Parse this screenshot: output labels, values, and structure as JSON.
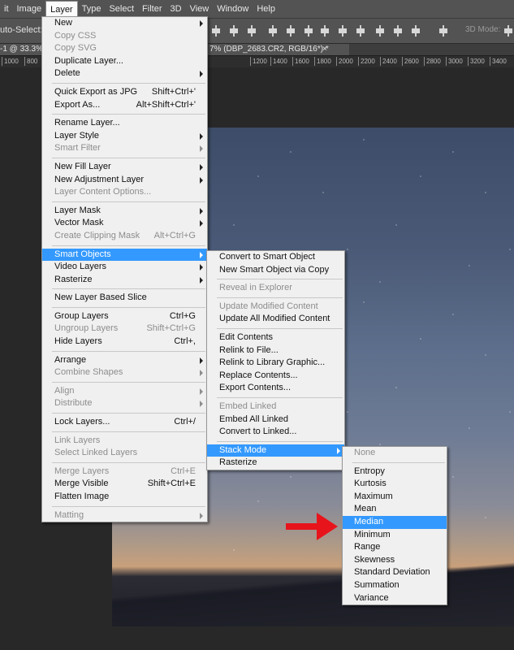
{
  "menubar": {
    "items": [
      {
        "label": "it"
      },
      {
        "label": "Image"
      },
      {
        "label": "Layer"
      },
      {
        "label": "Type"
      },
      {
        "label": "Select"
      },
      {
        "label": "Filter"
      },
      {
        "label": "3D"
      },
      {
        "label": "View"
      },
      {
        "label": "Window"
      },
      {
        "label": "Help"
      }
    ]
  },
  "options_bar": {
    "auto_select": "uto-Select:",
    "mode_3d": "3D Mode:"
  },
  "doc_tab": {
    "prefix": "-1 @ 33.3%",
    "title": "7% (DBP_2683.CR2, RGB/16*) *",
    "close": "×"
  },
  "ruler": {
    "ticks": [
      "1000",
      "800",
      "1200",
      "1400",
      "1600",
      "1800",
      "2000",
      "2200",
      "2400",
      "2600",
      "2800",
      "3000",
      "3200",
      "3400"
    ]
  },
  "layer_menu": {
    "items": [
      {
        "label": "New",
        "sub": true
      },
      {
        "label": "Copy CSS",
        "disabled": true
      },
      {
        "label": "Copy SVG",
        "disabled": true
      },
      {
        "label": "Duplicate Layer..."
      },
      {
        "label": "Delete",
        "sub": true
      },
      {
        "sep": true
      },
      {
        "label": "Quick Export as JPG",
        "shortcut": "Shift+Ctrl+'"
      },
      {
        "label": "Export As...",
        "shortcut": "Alt+Shift+Ctrl+'"
      },
      {
        "sep": true
      },
      {
        "label": "Rename Layer..."
      },
      {
        "label": "Layer Style",
        "sub": true
      },
      {
        "label": "Smart Filter",
        "sub": true,
        "disabled": true
      },
      {
        "sep": true
      },
      {
        "label": "New Fill Layer",
        "sub": true
      },
      {
        "label": "New Adjustment Layer",
        "sub": true
      },
      {
        "label": "Layer Content Options...",
        "disabled": true
      },
      {
        "sep": true
      },
      {
        "label": "Layer Mask",
        "sub": true
      },
      {
        "label": "Vector Mask",
        "sub": true
      },
      {
        "label": "Create Clipping Mask",
        "shortcut": "Alt+Ctrl+G",
        "disabled": true
      },
      {
        "sep": true
      },
      {
        "label": "Smart Objects",
        "sub": true,
        "highlighted": true
      },
      {
        "label": "Video Layers",
        "sub": true
      },
      {
        "label": "Rasterize",
        "sub": true
      },
      {
        "sep": true
      },
      {
        "label": "New Layer Based Slice"
      },
      {
        "sep": true
      },
      {
        "label": "Group Layers",
        "shortcut": "Ctrl+G"
      },
      {
        "label": "Ungroup Layers",
        "shortcut": "Shift+Ctrl+G",
        "disabled": true
      },
      {
        "label": "Hide Layers",
        "shortcut": "Ctrl+,"
      },
      {
        "sep": true
      },
      {
        "label": "Arrange",
        "sub": true
      },
      {
        "label": "Combine Shapes",
        "sub": true,
        "disabled": true
      },
      {
        "sep": true
      },
      {
        "label": "Align",
        "sub": true,
        "disabled": true
      },
      {
        "label": "Distribute",
        "sub": true,
        "disabled": true
      },
      {
        "sep": true
      },
      {
        "label": "Lock Layers...",
        "shortcut": "Ctrl+/"
      },
      {
        "sep": true
      },
      {
        "label": "Link Layers",
        "disabled": true
      },
      {
        "label": "Select Linked Layers",
        "disabled": true
      },
      {
        "sep": true
      },
      {
        "label": "Merge Layers",
        "shortcut": "Ctrl+E",
        "disabled": true
      },
      {
        "label": "Merge Visible",
        "shortcut": "Shift+Ctrl+E"
      },
      {
        "label": "Flatten Image"
      },
      {
        "sep": true
      },
      {
        "label": "Matting",
        "sub": true,
        "disabled": true
      }
    ]
  },
  "smart_objects_menu": {
    "items": [
      {
        "label": "Convert to Smart Object"
      },
      {
        "label": "New Smart Object via Copy"
      },
      {
        "sep": true
      },
      {
        "label": "Reveal in Explorer",
        "disabled": true
      },
      {
        "sep": true
      },
      {
        "label": "Update Modified Content",
        "disabled": true
      },
      {
        "label": "Update All Modified Content"
      },
      {
        "sep": true
      },
      {
        "label": "Edit Contents"
      },
      {
        "label": "Relink to File..."
      },
      {
        "label": "Relink to Library Graphic..."
      },
      {
        "label": "Replace Contents..."
      },
      {
        "label": "Export Contents..."
      },
      {
        "sep": true
      },
      {
        "label": "Embed Linked",
        "disabled": true
      },
      {
        "label": "Embed All Linked"
      },
      {
        "label": "Convert to Linked..."
      },
      {
        "sep": true
      },
      {
        "label": "Stack Mode",
        "sub": true,
        "highlighted": true
      },
      {
        "label": "Rasterize"
      }
    ]
  },
  "stack_mode_menu": {
    "items": [
      {
        "label": "None",
        "disabled": true
      },
      {
        "sep": true
      },
      {
        "label": "Entropy"
      },
      {
        "label": "Kurtosis"
      },
      {
        "label": "Maximum"
      },
      {
        "label": "Mean"
      },
      {
        "label": "Median",
        "highlighted": true
      },
      {
        "label": "Minimum"
      },
      {
        "label": "Range"
      },
      {
        "label": "Skewness"
      },
      {
        "label": "Standard Deviation"
      },
      {
        "label": "Summation"
      },
      {
        "label": "Variance"
      }
    ]
  },
  "colors": {
    "highlight": "#3399ff",
    "arrow": "#e8141c",
    "menu_bg": "#f0f0f0",
    "chrome": "#535353"
  }
}
